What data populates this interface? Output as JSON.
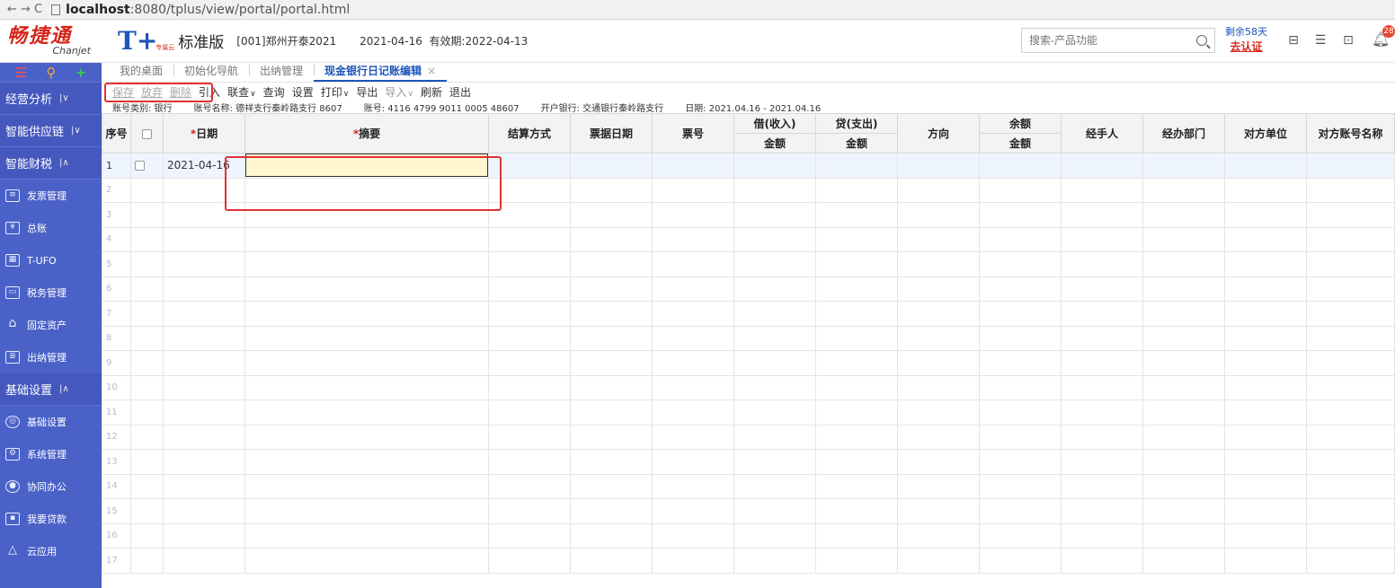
{
  "browser": {
    "nav": "← → C",
    "url_host": "localhost",
    "url_rest": ":8080/tplus/view/portal/portal.html"
  },
  "header": {
    "logo_cn": "畅捷通",
    "logo_en": "Chanjet",
    "product_mark": "T+",
    "product_sub": "专属云",
    "edition": "标准版",
    "account": "[001]郑州开泰2021",
    "date": "2021-04-16",
    "validity": "有效期:2022-04-13",
    "search_placeholder": "搜索-产品功能",
    "trial_days": "剩余58天",
    "certify": "去认证",
    "badge": "28"
  },
  "sidebar": {
    "top_icons": [
      "menu-icon",
      "search-icon",
      "plus-icon"
    ],
    "groups": [
      {
        "label": "经营分析",
        "arrow": "|∨"
      },
      {
        "label": "智能供应链",
        "arrow": "|∨"
      },
      {
        "label": "智能财税",
        "arrow": "|∧"
      }
    ],
    "finance_items": [
      "发票管理",
      "总账",
      "T-UFO",
      "税务管理",
      "固定资产",
      "出纳管理"
    ],
    "basic_group": {
      "label": "基础设置",
      "arrow": "|∧"
    },
    "basic_items": [
      "基础设置",
      "系统管理",
      "协同办公",
      "我要贷款",
      "云应用"
    ]
  },
  "tabs": [
    {
      "label": "我的桌面"
    },
    {
      "label": "初始化导航"
    },
    {
      "label": "出纳管理"
    },
    {
      "label": "现金银行日记账编辑",
      "active": true
    }
  ],
  "toolbar": {
    "save": "保存",
    "discard": "放弃",
    "delete": "删除",
    "import_ref": "引入",
    "link": "联查",
    "query": "查询",
    "settings": "设置",
    "print": "打印",
    "export": "导出",
    "import": "导入",
    "refresh": "刷新",
    "exit": "退出"
  },
  "infobar": {
    "account_type": "账号类别: 银行",
    "account_name": "账号名称: 德祥支行秦岭路支行 8607",
    "account_no": "账号: 4116 4799 9011 0005 48607",
    "bank": "开户银行: 交通银行秦岭路支行",
    "date_range": "日期: 2021.04.16 - 2021.04.16"
  },
  "grid": {
    "headers": {
      "seq": "序号",
      "date": "日期",
      "summary": "摘要",
      "settle": "结算方式",
      "bill_date": "票据日期",
      "bill_no": "票号",
      "debit": "借(收入)",
      "credit": "贷(支出)",
      "direction": "方向",
      "balance": "余额",
      "amount": "金额",
      "handler": "经手人",
      "dept": "经办部门",
      "party": "对方单位",
      "party_account": "对方账号名称"
    },
    "required_mark": "*",
    "first_row_date": "2021-04-16",
    "row_numbers": [
      "1",
      "2",
      "3",
      "4",
      "5",
      "6",
      "7",
      "8",
      "9",
      "10",
      "11",
      "12",
      "13",
      "14",
      "15",
      "16",
      "17"
    ]
  }
}
